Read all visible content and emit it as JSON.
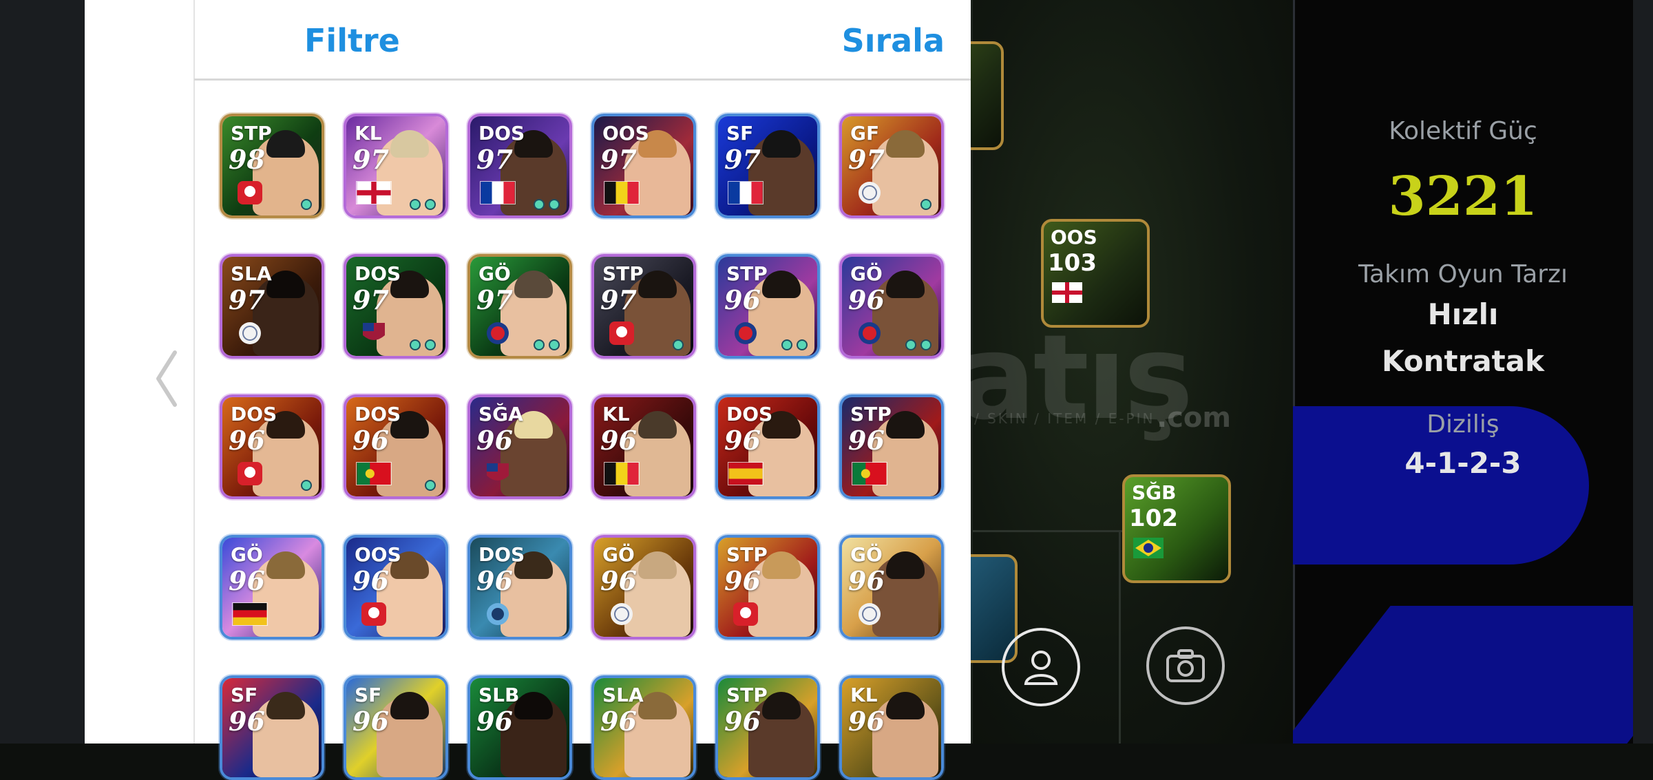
{
  "modal": {
    "filter_label": "Filtre",
    "sort_label": "Sırala",
    "cards": [
      {
        "pos": "STP",
        "rating": "98",
        "frame": "#b48a44",
        "bg": "linear-gradient(135deg,#3a8a2a 0%,#0f3d12 55%,#222 100%)",
        "flag": "badge-red",
        "skin": "#e2b48c",
        "hair": "#1a1a1a",
        "dots": 1
      },
      {
        "pos": "KL",
        "rating": "97",
        "frame": "#b46ad8",
        "bg": "linear-gradient(135deg,#6a2aa0 0%,#d88ad8 50%,#3a1a6a 100%)",
        "flag": "england",
        "skin": "#f0c8a8",
        "hair": "#d8c8a0",
        "dots": 2
      },
      {
        "pos": "DOS",
        "rating": "97",
        "frame": "#b46ad8",
        "bg": "linear-gradient(135deg,#2a1a6a 0%,#6a3ab0 60%,#1a1040 100%)",
        "flag": "france",
        "skin": "#5a3a2a",
        "hair": "#1a1410",
        "dots": 2
      },
      {
        "pos": "OOS",
        "rating": "97",
        "frame": "#4a8ad8",
        "bg": "linear-gradient(135deg,#1a1a4a 0%,#a02a3a 60%,#3a0a1a 100%)",
        "flag": "belgium",
        "skin": "#e8b898",
        "hair": "#c8884a",
        "dots": 0
      },
      {
        "pos": "SF",
        "rating": "97",
        "frame": "#4a8ad8",
        "bg": "linear-gradient(135deg,#1a3ad8 0%,#0a1a8a 60%,#0a0a3a 100%)",
        "flag": "france",
        "skin": "#5a3a2a",
        "hair": "#141414",
        "dots": 0
      },
      {
        "pos": "GF",
        "rating": "97",
        "frame": "#b46ad8",
        "bg": "linear-gradient(135deg,#d89a2a 0%,#a02a1a 60%,#3a0a0a 100%)",
        "flag": "badge-white",
        "skin": "#e8c0a0",
        "hair": "#8a6a3a",
        "dots": 1
      },
      {
        "pos": "SLA",
        "rating": "97",
        "frame": "#b46ad8",
        "bg": "linear-gradient(135deg,#8a4a1a 0%,#3a1a0a 60%,#1a0a04 100%)",
        "flag": "badge-white",
        "skin": "#3a2418",
        "hair": "#0e0a08",
        "dots": 0
      },
      {
        "pos": "DOS",
        "rating": "97",
        "frame": "#b46ad8",
        "bg": "linear-gradient(135deg,#1a6a2a 0%,#0a3a14 60%,#050f06 100%)",
        "flag": "badge-barca",
        "skin": "#e0b490",
        "hair": "#1a1410",
        "dots": 2
      },
      {
        "pos": "GÖ",
        "rating": "97",
        "frame": "#b48a44",
        "bg": "linear-gradient(135deg,#2a9a3a 0%,#0a3a14 60%,#06140a 100%)",
        "flag": "badge-blue",
        "skin": "#e8c0a0",
        "hair": "#5a4a3a",
        "dots": 2
      },
      {
        "pos": "STP",
        "rating": "97",
        "frame": "#b46ad8",
        "bg": "linear-gradient(135deg,#4a4a5a 0%,#1a1a24 60%,#0a0a10 100%)",
        "flag": "badge-red",
        "skin": "#7a5238",
        "hair": "#1a1410",
        "dots": 1
      },
      {
        "pos": "STP",
        "rating": "96",
        "frame": "#4a8ad8",
        "bg": "linear-gradient(135deg,#2a3a9a 0%,#a03aa0 60%,#1a0a3a 100%)",
        "flag": "badge-blue",
        "skin": "#e4b894",
        "hair": "#1a1410",
        "dots": 2
      },
      {
        "pos": "GÖ",
        "rating": "96",
        "frame": "#b46ad8",
        "bg": "linear-gradient(135deg,#2a3a9a 0%,#a03aa0 60%,#1a0a3a 100%)",
        "flag": "badge-blue",
        "skin": "#7a5238",
        "hair": "#1a1410",
        "dots": 2
      },
      {
        "pos": "DOS",
        "rating": "96",
        "frame": "#b46ad8",
        "bg": "linear-gradient(135deg,#d86a1a 0%,#7a1a0a 60%,#2a0a04 100%)",
        "flag": "badge-red",
        "skin": "#e4b894",
        "hair": "#2a1a10",
        "dots": 1
      },
      {
        "pos": "DOS",
        "rating": "96",
        "frame": "#b46ad8",
        "bg": "linear-gradient(135deg,#d86a1a 0%,#7a1a0a 60%,#2a0a04 100%)",
        "flag": "portugal",
        "skin": "#d8a884",
        "hair": "#1a1410",
        "dots": 1
      },
      {
        "pos": "SĞA",
        "rating": "96",
        "frame": "#b46ad8",
        "bg": "linear-gradient(135deg,#2a2a8a 0%,#8a1a3a 60%,#1a0a2a 100%)",
        "flag": "badge-barca",
        "skin": "#6a4430",
        "hair": "#e8d8a0",
        "dots": 0
      },
      {
        "pos": "KL",
        "rating": "96",
        "frame": "#b46ad8",
        "bg": "linear-gradient(135deg,#8a1a1a 0%,#3a0a0a 60%,#1a0404 100%)",
        "flag": "belgium",
        "skin": "#e0b894",
        "hair": "#4a3a2a",
        "dots": 0
      },
      {
        "pos": "DOS",
        "rating": "96",
        "frame": "#4a8ad8",
        "bg": "linear-gradient(135deg,#c82a1a 0%,#6a0a0a 60%,#2a0404 100%)",
        "flag": "spain",
        "skin": "#e8c0a0",
        "hair": "#2a1a10",
        "dots": 0
      },
      {
        "pos": "STP",
        "rating": "96",
        "frame": "#4a8ad8",
        "bg": "linear-gradient(135deg,#1a2a6a 0%,#a01a1a 60%,#1a0a1a 100%)",
        "flag": "portugal",
        "skin": "#e0b490",
        "hair": "#1a1410",
        "dots": 0
      },
      {
        "pos": "GÖ",
        "rating": "96",
        "frame": "#4a8ad8",
        "bg": "linear-gradient(135deg,#3a4ad8 0%,#d88ae0 50%,#1a1a6a 100%)",
        "flag": "germany",
        "skin": "#f0c8a8",
        "hair": "#8a6a3a",
        "dots": 0
      },
      {
        "pos": "OOS",
        "rating": "96",
        "frame": "#4a8ad8",
        "bg": "linear-gradient(135deg,#1a2a8a 0%,#3a6ad8 50%,#1a1a5a 100%)",
        "flag": "badge-red",
        "skin": "#f0c8a8",
        "hair": "#6a4a2a",
        "dots": 0
      },
      {
        "pos": "DOS",
        "rating": "96",
        "frame": "#4a8ad8",
        "bg": "linear-gradient(135deg,#1a4a5a 0%,#3a8ab0 50%,#0a2a3a 100%)",
        "flag": "badge-sky",
        "skin": "#e8c0a0",
        "hair": "#3a2a1a",
        "dots": 0
      },
      {
        "pos": "GÖ",
        "rating": "96",
        "frame": "#b46ad8",
        "bg": "linear-gradient(135deg,#d8a02a 0%,#6a3a0a 60%,#1a0a04 100%)",
        "flag": "badge-white",
        "skin": "#e8c8a8",
        "hair": "#c8a880",
        "dots": 0
      },
      {
        "pos": "STP",
        "rating": "96",
        "frame": "#4a8ad8",
        "bg": "linear-gradient(135deg,#d8a02a 0%,#a01a1a 60%,#2a0404 100%)",
        "flag": "badge-red",
        "skin": "#e8c0a0",
        "hair": "#c89a5a",
        "dots": 0
      },
      {
        "pos": "GÖ",
        "rating": "96",
        "frame": "#4a8ad8",
        "bg": "linear-gradient(135deg,#f0e0a0 0%,#d8a04a 50%,#4a2a0a 100%)",
        "flag": "badge-white",
        "skin": "#7a5238",
        "hair": "#1a1410",
        "dots": 0
      },
      {
        "pos": "SF",
        "rating": "96",
        "frame": "#4a8ad8",
        "bg": "linear-gradient(135deg,#d82a3a 0%,#1a2a8a 60%,#0a0a2a 100%)",
        "flag": "none",
        "skin": "#e8c0a0",
        "hair": "#3a2a1a",
        "dots": 0
      },
      {
        "pos": "SF",
        "rating": "96",
        "frame": "#4a8ad8",
        "bg": "linear-gradient(135deg,#2a6ad8 0%,#e0d02a 50%,#1a3a6a 100%)",
        "flag": "none",
        "skin": "#d8a884",
        "hair": "#1a1410",
        "dots": 0
      },
      {
        "pos": "SLB",
        "rating": "96",
        "frame": "#4a8ad8",
        "bg": "linear-gradient(135deg,#1a8a3a 0%,#0a3a1a 60%,#04140a 100%)",
        "flag": "none",
        "skin": "#3a2418",
        "hair": "#0e0a08",
        "dots": 0
      },
      {
        "pos": "SLA",
        "rating": "96",
        "frame": "#4a8ad8",
        "bg": "linear-gradient(135deg,#1a8a3a 0%,#d8a02a 60%,#3a2a04 100%)",
        "flag": "none",
        "skin": "#e8c0a0",
        "hair": "#8a6a3a",
        "dots": 0
      },
      {
        "pos": "STP",
        "rating": "96",
        "frame": "#4a8ad8",
        "bg": "linear-gradient(135deg,#1a8a3a 0%,#d8a02a 60%,#3a2a04 100%)",
        "flag": "none",
        "skin": "#5a3a2a",
        "hair": "#1a1410",
        "dots": 0
      },
      {
        "pos": "KL",
        "rating": "96",
        "frame": "#4a8ad8",
        "bg": "linear-gradient(135deg,#d8a02a 0%,#6a5a1a 60%,#1a1404 100%)",
        "flag": "none",
        "skin": "#d8a884",
        "hair": "#1a1410",
        "dots": 0
      }
    ]
  },
  "pitch": {
    "players": [
      {
        "pos": "OOS",
        "rating": "103",
        "flag": "england"
      },
      {
        "pos": "SĞB",
        "rating": "102",
        "flag": "brazil"
      }
    ],
    "watermark": "atış",
    "watermark_sub": "/ SKIN / ITEM / E-PIN",
    "watermark_com": ".com"
  },
  "stats": {
    "collective_label": "Kolektif Güç",
    "collective_value": "3221",
    "style_label": "Takım Oyun Tarzı",
    "style_value_1": "Hızlı",
    "style_value_2": "Kontratak",
    "formation_label": "Diziliş",
    "formation_value": "4-1-2-3"
  },
  "colors": {
    "accent": "#1e8fe0",
    "power": "#c8d21a"
  },
  "icons": [
    "back-chevron-icon",
    "profile-icon",
    "camera-icon"
  ]
}
